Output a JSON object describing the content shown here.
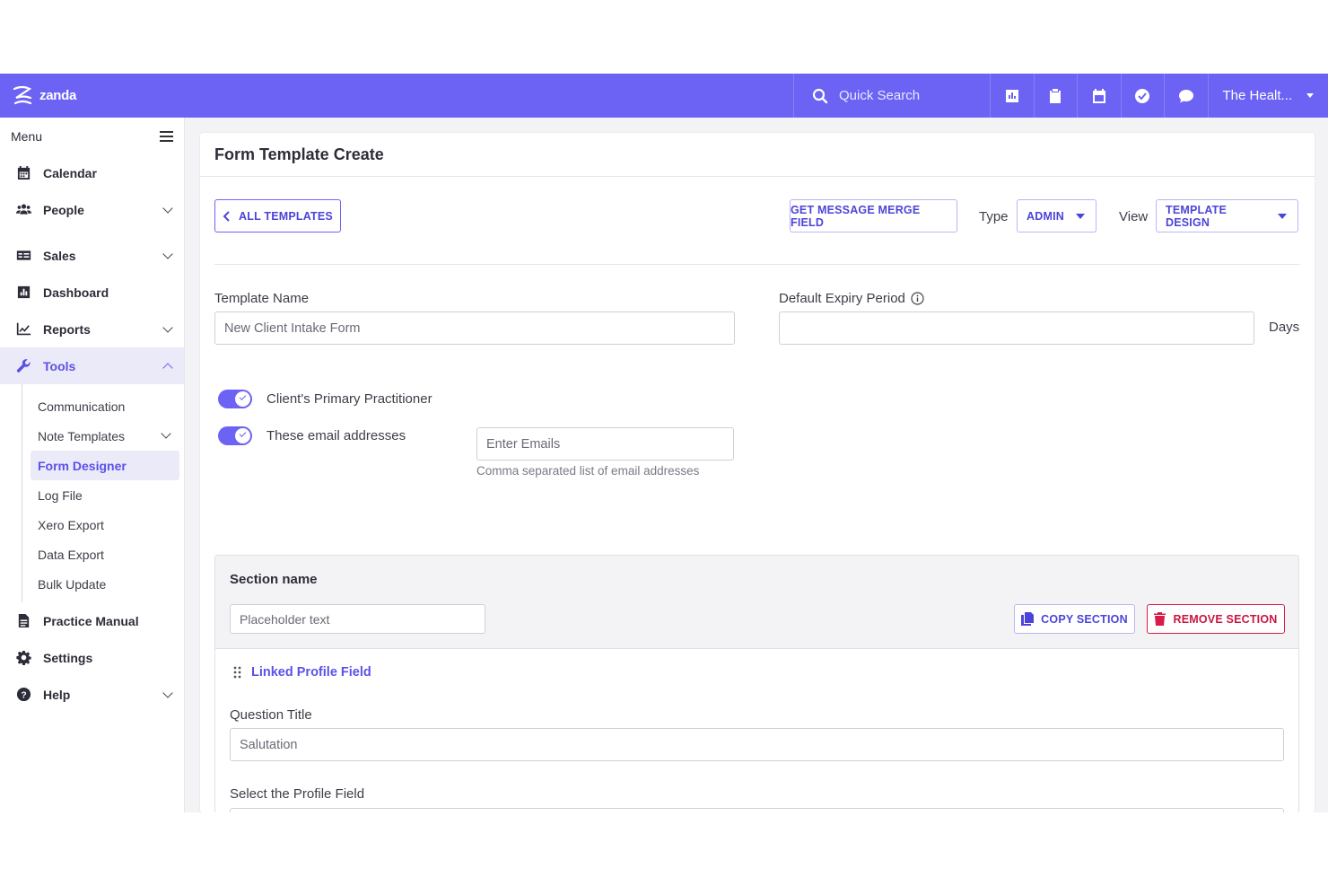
{
  "topbar": {
    "brand": "zanda",
    "search_placeholder": "Quick Search",
    "icons": [
      "chart-icon",
      "clipboard-icon",
      "calendar-icon",
      "check-circle-icon",
      "chat-icon"
    ],
    "account": "The Healt..."
  },
  "sidebar": {
    "menu_label": "Menu",
    "items": [
      {
        "label": "Calendar",
        "icon": "calendar-icon"
      },
      {
        "label": "People",
        "icon": "people-icon"
      },
      {
        "label": "Sales",
        "icon": "sales-icon"
      },
      {
        "label": "Dashboard",
        "icon": "dashboard-icon"
      },
      {
        "label": "Reports",
        "icon": "reports-icon"
      },
      {
        "label": "Tools",
        "icon": "wrench-icon"
      }
    ],
    "tools_sub": [
      "Communication",
      "Note Templates",
      "Form Designer",
      "Log File",
      "Xero Export",
      "Data Export",
      "Bulk Update"
    ],
    "bottom_items": [
      {
        "label": "Practice Manual",
        "icon": "document-icon"
      },
      {
        "label": "Settings",
        "icon": "gear-icon"
      },
      {
        "label": "Help",
        "icon": "help-icon"
      }
    ]
  },
  "main": {
    "title": "Form Template Create",
    "all_templates": "ALL TEMPLATES",
    "merge_field": "GET MESSAGE MERGE FIELD",
    "type_label": "Type",
    "type_value": "ADMIN",
    "view_label": "View",
    "view_value": "TEMPLATE DESIGN",
    "template_name_label": "Template Name",
    "template_name_placeholder": "New Client Intake Form",
    "expiry_label": "Default Expiry Period",
    "expiry_unit": "Days",
    "toggle_primary": "Client's Primary Practitioner",
    "toggle_emails": "These email addresses",
    "emails_placeholder": "Enter Emails",
    "emails_help": "Comma separated list of email addresses"
  },
  "section": {
    "name_label": "Section name",
    "name_placeholder": "Placeholder text",
    "copy": "COPY SECTION",
    "remove": "REMOVE SECTION",
    "linked": "Linked Profile Field",
    "question_title_label": "Question Title",
    "question_title_value": "Salutation",
    "profile_field_label": "Select the Profile Field"
  },
  "colors": {
    "accent": "#6c63f5",
    "danger": "#d81b4a"
  }
}
